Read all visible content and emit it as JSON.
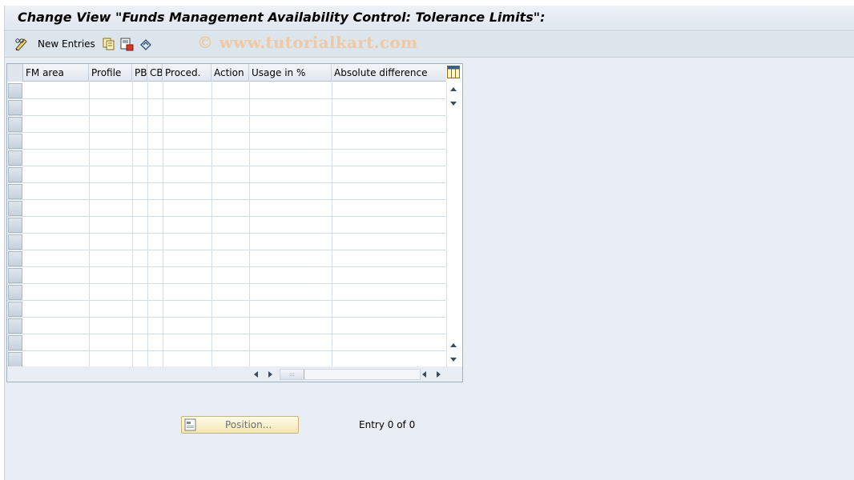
{
  "window": {
    "title": "Change View \"Funds Management Availability Control: Tolerance Limits\":"
  },
  "toolbar": {
    "new_entries_label": "New Entries",
    "icons": [
      "change-display-icon",
      "copy-icon",
      "save-as-icon",
      "undo-icon"
    ]
  },
  "watermark": "© www.tutorialkart.com",
  "table": {
    "columns": [
      "FM area",
      "Profile",
      "PB",
      "CB",
      "Proced.",
      "Action",
      "Usage in %",
      "Absolute difference"
    ],
    "row_count": 17
  },
  "footer": {
    "position_button": "Position...",
    "entry_count": "Entry 0 of 0"
  },
  "colors": {
    "background": "#e9eef4",
    "toolbar": "#dce4ec",
    "position_button": "#f7efcb",
    "watermark": "#f0c9a4"
  }
}
